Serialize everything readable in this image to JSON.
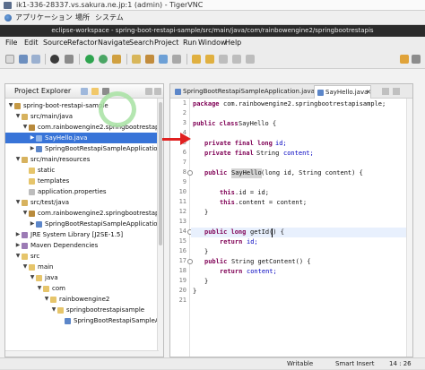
{
  "vnc": {
    "title": "ik1-336-28337.vs.sakura.ne.jp:1 (admin) - TigerVNC"
  },
  "desktop": {
    "menu": [
      "アプリケーション",
      "場所",
      "システム"
    ]
  },
  "eclipse": {
    "title": "eclipse-workspace - spring-boot-restapi-sample/src/main/java/com/rainbowengine2/springbootrestapis",
    "menu": [
      "File",
      "Edit",
      "Source",
      "Refactor",
      "Navigate",
      "Search",
      "Project",
      "Run",
      "Window",
      "Help"
    ]
  },
  "explorer": {
    "tab_label": "Project Explorer",
    "items": [
      {
        "label": "spring-boot-restapi-sample",
        "icon": "project-icon",
        "expanded": true
      },
      {
        "label": "src/main/java",
        "icon": "source-folder-icon",
        "expanded": true
      },
      {
        "label": "com.rainbowengine2.springbootrestapisa",
        "icon": "package-icon",
        "expanded": true
      },
      {
        "label": "SayHello.java",
        "icon": "java-file-icon",
        "expanded": false,
        "selected": true
      },
      {
        "label": "SpringBootRestapiSampleApplication.ja",
        "icon": "java-file-icon",
        "expanded": false
      },
      {
        "label": "src/main/resources",
        "icon": "source-folder-icon",
        "expanded": true
      },
      {
        "label": "static",
        "icon": "folder-icon"
      },
      {
        "label": "templates",
        "icon": "folder-icon"
      },
      {
        "label": "application.properties",
        "icon": "properties-file-icon"
      },
      {
        "label": "src/test/java",
        "icon": "source-folder-icon",
        "expanded": true
      },
      {
        "label": "com.rainbowengine2.springbootrestapisa",
        "icon": "package-icon",
        "expanded": true
      },
      {
        "label": "SpringBootRestapiSampleApplicationTes",
        "icon": "java-file-icon"
      },
      {
        "label": "JRE System Library [J2SE-1.5]",
        "icon": "library-icon"
      },
      {
        "label": "Maven Dependencies",
        "icon": "library-icon"
      },
      {
        "label": "src",
        "icon": "folder-icon",
        "expanded": true
      },
      {
        "label": "main",
        "icon": "folder-icon",
        "expanded": true
      },
      {
        "label": "java",
        "icon": "folder-icon",
        "expanded": true
      },
      {
        "label": "com",
        "icon": "folder-icon",
        "expanded": true
      },
      {
        "label": "rainbowengine2",
        "icon": "folder-icon",
        "expanded": true
      },
      {
        "label": "springbootrestapisample",
        "icon": "folder-icon",
        "expanded": true
      },
      {
        "label": "SpringBootRestapiSampleApplicat",
        "icon": "java-file-icon"
      }
    ]
  },
  "editor": {
    "tabs": [
      {
        "label": "SpringBootRestapiSampleApplication.java",
        "active": false
      },
      {
        "label": "SayHello.java",
        "active": true
      }
    ],
    "line_numbers": [
      "1",
      "2",
      "3",
      "4",
      "5",
      "6",
      "7",
      "8",
      "9",
      "10",
      "11",
      "12",
      "13",
      "14",
      "15",
      "16",
      "17",
      "18",
      "19",
      "20",
      "21"
    ],
    "code": {
      "l1_kw": "package",
      "l1_rest": "com.rainbowengine2.springbootrestapisample;",
      "l3_kw": "public class",
      "l3_rest": "SayHello {",
      "l5_kw": "private final long",
      "l5_field": "id;",
      "l6_kw": "private final",
      "l6_type": "String",
      "l6_field": "content;",
      "l8_kw": "public",
      "l8_name": "SayHello",
      "l8_rest": "(long id, String content) {",
      "l10_kw": "this",
      "l10_rest": ".id = id;",
      "l11_kw": "this",
      "l11_rest": ".content = content;",
      "l12": "}",
      "l14_kw": "public long",
      "l14_rest": "getId() {",
      "l15_kw": "return",
      "l15_field": "id;",
      "l16": "}",
      "l17_kw": "public",
      "l17_rest": "String getContent() {",
      "l18_kw": "return",
      "l18_field": "content;",
      "l19": "}",
      "l20": "}"
    }
  },
  "status": {
    "mode": "Writable",
    "insert": "Smart Insert",
    "position": "14 : 26"
  },
  "colors": {
    "keyword": "#7f0055",
    "field": "#0000c0",
    "selection": "#3874d8",
    "annotation_arrow": "#e02020",
    "annotation_ring": "#a7e2a2"
  }
}
